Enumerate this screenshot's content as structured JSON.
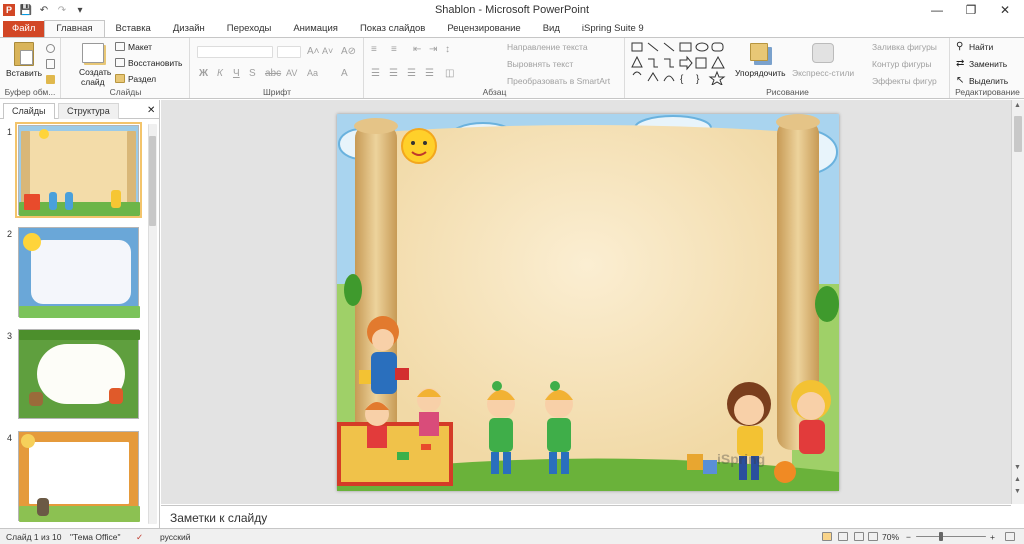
{
  "window": {
    "title": "Shablon  -  Microsoft PowerPoint"
  },
  "tabs": [
    {
      "label": "Файл"
    },
    {
      "label": "Главная"
    },
    {
      "label": "Вставка"
    },
    {
      "label": "Дизайн"
    },
    {
      "label": "Переходы"
    },
    {
      "label": "Анимация"
    },
    {
      "label": "Показ слайдов"
    },
    {
      "label": "Рецензирование"
    },
    {
      "label": "Вид"
    },
    {
      "label": "iSpring Suite 9"
    }
  ],
  "ribbon": {
    "clipboard": {
      "paste": "Вставить",
      "group": "Буфер обм..."
    },
    "slides": {
      "create": "Создать",
      "create2": "слайд",
      "layout": "Макет",
      "reset": "Восстановить",
      "section": "Раздел",
      "group": "Слайды"
    },
    "font": {
      "group": "Шрифт"
    },
    "paragraph": {
      "text_dir": "Направление текста",
      "align_text": "Выровнять текст",
      "smartart": "Преобразовать в SmartArt",
      "group": "Абзац"
    },
    "drawing": {
      "arrange": "Упорядочить",
      "quick_styles": "Экспресс-стили",
      "fill": "Заливка фигуры",
      "outline": "Контур фигуры",
      "effects": "Эффекты фигур",
      "group": "Рисование"
    },
    "editing": {
      "find": "Найти",
      "replace": "Заменить",
      "select": "Выделить",
      "group": "Редактирование"
    }
  },
  "pane": {
    "tab_slides": "Слайды",
    "tab_outline": "Структура"
  },
  "thumbnails": [
    {
      "num": "1"
    },
    {
      "num": "2"
    },
    {
      "num": "3"
    },
    {
      "num": "4"
    }
  ],
  "notes": {
    "placeholder": "Заметки к слайду"
  },
  "status": {
    "slide": "Слайд 1 из 10",
    "theme": "\"Тема Office\"",
    "lang": "русский",
    "zoom": "70%"
  },
  "slide_text": {
    "watermark": "iSpring"
  }
}
